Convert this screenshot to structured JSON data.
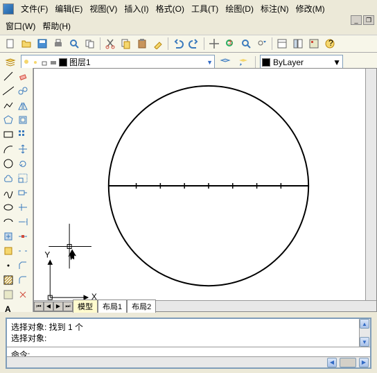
{
  "menu": {
    "file": "文件(F)",
    "edit": "编辑(E)",
    "view": "视图(V)",
    "insert": "插入(I)",
    "format": "格式(O)",
    "tools": "工具(T)",
    "draw": "绘图(D)",
    "dimension": "标注(N)",
    "modify": "修改(M)",
    "window": "窗口(W)",
    "help": "帮助(H)"
  },
  "layer": {
    "name": "图层1",
    "bylayer": "ByLayer"
  },
  "tabs": {
    "model": "模型",
    "layout1": "布局1",
    "layout2": "布局2"
  },
  "ucs": {
    "x": "X",
    "y": "Y"
  },
  "cmd": {
    "line1": "选择对象: 找到 1 个",
    "line2": "选择对象:",
    "prompt": "命令:"
  },
  "colors": {
    "bg_toolbar": "#f7f6e9",
    "accent": "#316ac5"
  }
}
